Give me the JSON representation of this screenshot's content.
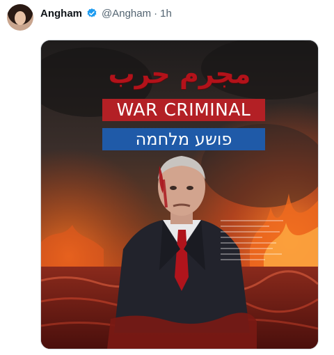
{
  "tweet": {
    "display_name": "Angham",
    "handle": "@Angham",
    "separator": "·",
    "time": "1h",
    "verified_color": "#1d9bf0"
  },
  "image": {
    "arabic_title": "مجرم حرب",
    "english_banner": "WAR CRIMINAL",
    "hebrew_banner": "פושע מלחמה",
    "colors": {
      "red_banner": "#b32025",
      "blue_banner": "#1f5aa8",
      "arabic_text": "#b3121a"
    }
  }
}
